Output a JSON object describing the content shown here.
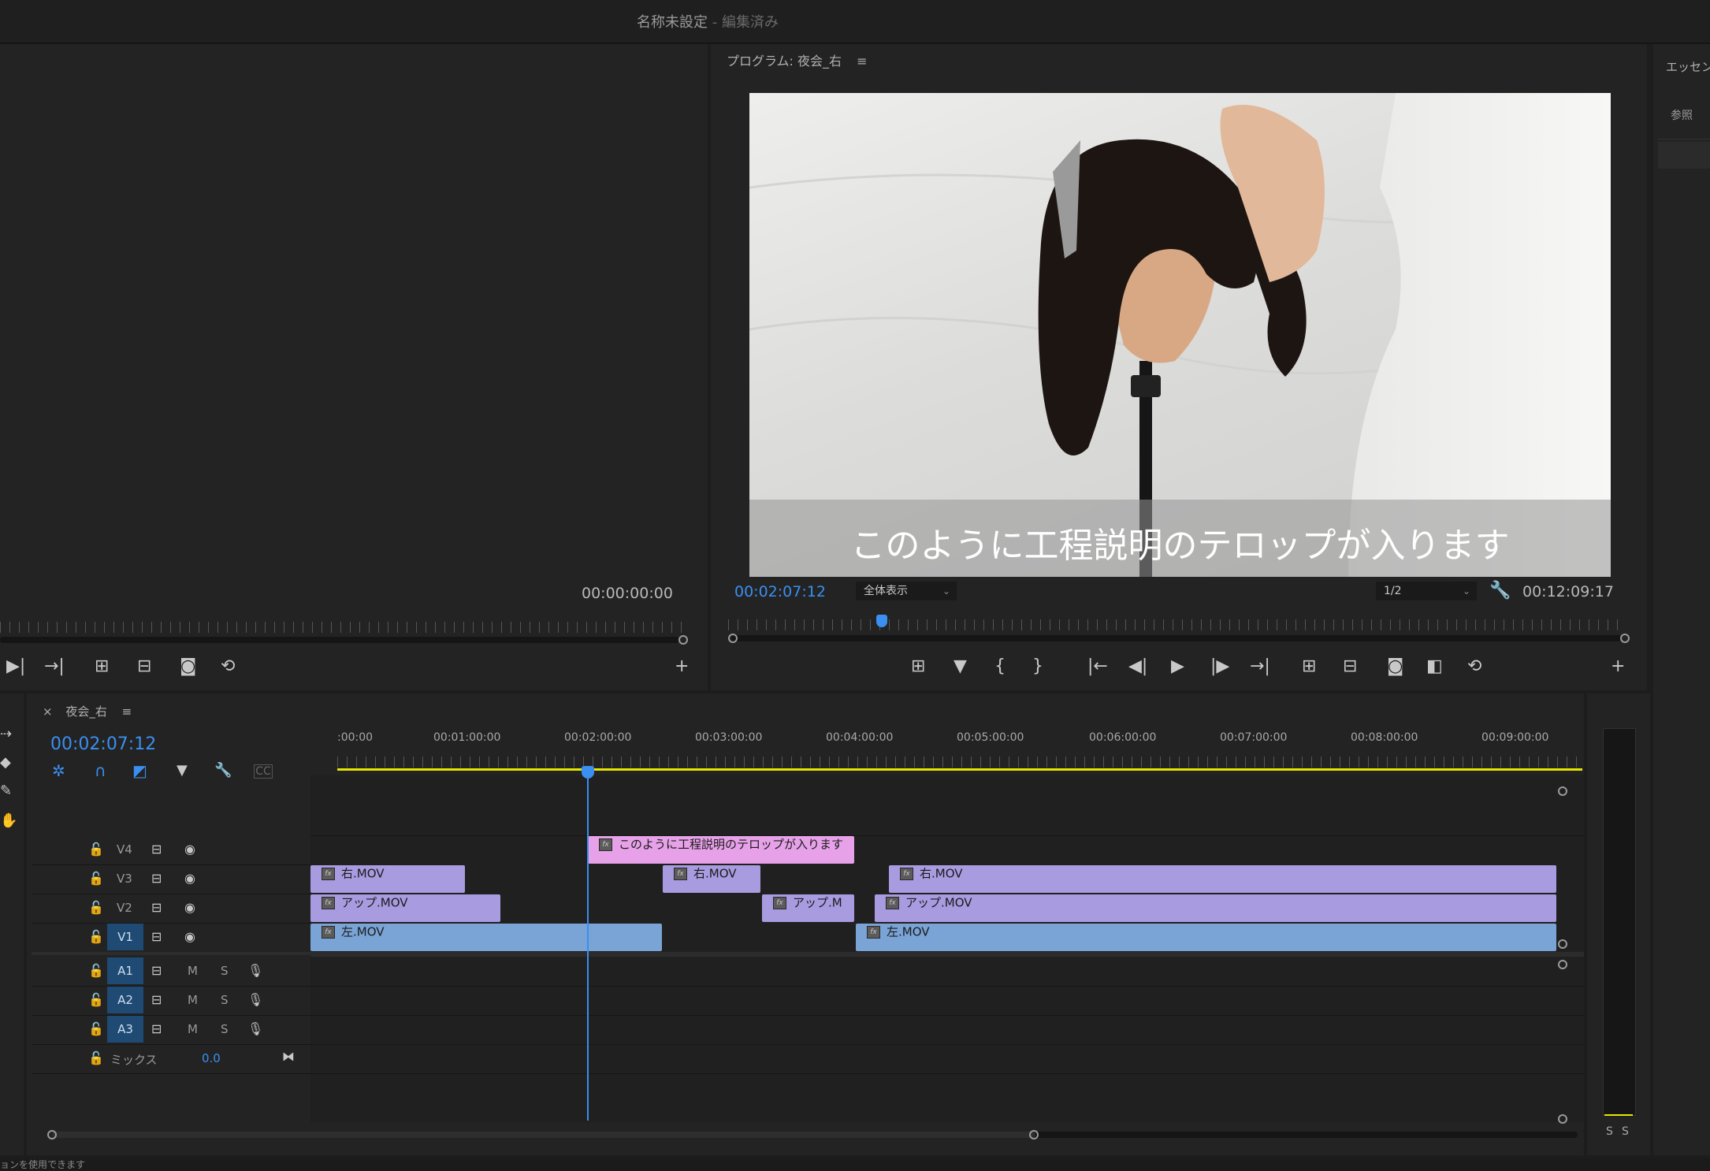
{
  "window": {
    "project_name": "名称未設定",
    "separator": " - ",
    "status": "編集済み"
  },
  "source_monitor": {
    "timecode": "00:00:00:00"
  },
  "program_monitor": {
    "title": "プログラム: 夜会_右",
    "subtitle_overlay": "このように工程説明のテロップが入ります",
    "current_timecode": "00:02:07:12",
    "zoom_select": "全体表示",
    "resolution_select": "1/2",
    "duration": "00:12:09:17",
    "playhead_position_fraction": 0.165
  },
  "right_panel": {
    "tab1": "エッセン",
    "tab2": "参照"
  },
  "timeline": {
    "sequence_name": "夜会_右",
    "timecode": "00:02:07:12",
    "ruler_labels": [
      ":00:00",
      "00:01:00:00",
      "00:02:00:00",
      "00:03:00:00",
      "00:04:00:00",
      "00:05:00:00",
      "00:06:00:00",
      "00:07:00:00",
      "00:08:00:00",
      "00:09:00:00"
    ],
    "video_tracks": [
      {
        "name": "V4",
        "targeted": false
      },
      {
        "name": "V3",
        "targeted": false
      },
      {
        "name": "V2",
        "targeted": false
      },
      {
        "name": "V1",
        "targeted": true
      }
    ],
    "audio_tracks": [
      {
        "name": "A1",
        "m": "M",
        "s": "S"
      },
      {
        "name": "A2",
        "m": "M",
        "s": "S"
      },
      {
        "name": "A3",
        "m": "M",
        "s": "S"
      }
    ],
    "mix": {
      "label": "ミックス",
      "value": "0.0"
    },
    "clips": {
      "v4_1": "このように工程説明のテロップが入ります",
      "v3_1": "右.MOV",
      "v3_2": "右.MOV",
      "v3_3": "右.MOV",
      "v2_1": "アップ.MOV",
      "v2_2": "アップ.M",
      "v2_3": "アップ.MOV",
      "v1_1": "左.MOV",
      "v1_2": "左.MOV"
    },
    "fx_badge": "fx"
  },
  "audio_meter": {
    "solo_left": "S",
    "solo_right": "S"
  },
  "status_bar": {
    "text": "ョンを使用できます"
  },
  "colors": {
    "accent_blue": "#3a8ff0",
    "clip_video": "#a99be0",
    "clip_v1": "#7aa3d6",
    "clip_graphic": "#e7a1e8",
    "work_area": "#e6e600"
  }
}
